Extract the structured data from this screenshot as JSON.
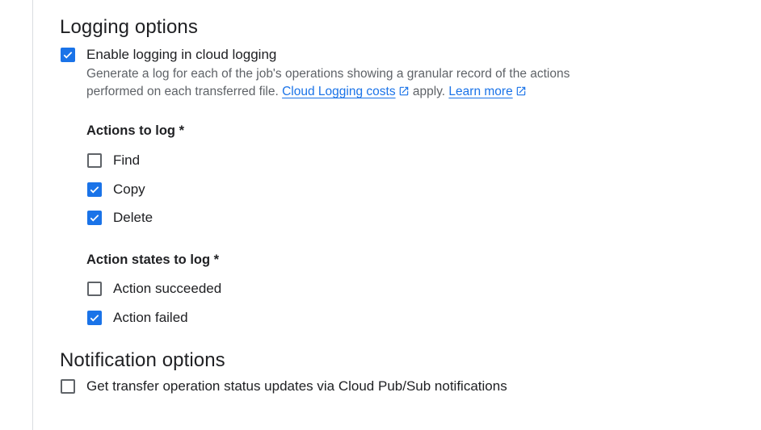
{
  "logging": {
    "title": "Logging options",
    "enable_label": "Enable logging in cloud logging",
    "enable_checked": true,
    "helper_prefix": "Generate a log for each of the job's operations showing a granular record of the actions performed on each transferred file.",
    "cost_link": "Cloud Logging costs",
    "helper_mid": "apply.",
    "learn_more_link": "Learn more",
    "actions": {
      "title": "Actions to log *",
      "items": [
        {
          "label": "Find",
          "checked": false
        },
        {
          "label": "Copy",
          "checked": true
        },
        {
          "label": "Delete",
          "checked": true
        }
      ]
    },
    "states": {
      "title": "Action states to log *",
      "items": [
        {
          "label": "Action succeeded",
          "checked": false
        },
        {
          "label": "Action failed",
          "checked": true
        }
      ]
    }
  },
  "notification": {
    "title": "Notification options",
    "pubsub_label": "Get transfer operation status updates via Cloud Pub/Sub notifications",
    "pubsub_checked": false
  },
  "colors": {
    "accent": "#1a73e8",
    "text": "#202124",
    "secondary_text": "#5f6368",
    "divider": "#dadce0"
  },
  "icons": {
    "checkmark": "check-icon",
    "external_link": "open-in-new-icon"
  }
}
